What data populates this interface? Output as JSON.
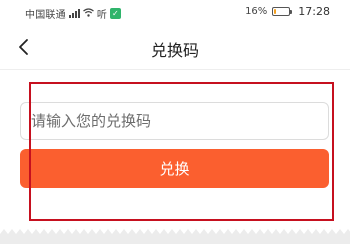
{
  "status_bar": {
    "carrier": "中国联通",
    "network_speed": "听",
    "battery_percent": "16%",
    "battery_level": 0.16,
    "time": "17:28"
  },
  "nav": {
    "title": "兑换码",
    "back_icon": "chevron-left-icon"
  },
  "form": {
    "code_placeholder": "请输入您的兑换码",
    "code_value": "",
    "redeem_label": "兑换"
  },
  "colors": {
    "accent": "#fb5f2f",
    "highlight_border": "#c6101f",
    "battery_fill": "#f4a020",
    "app_badge": "#2fb46b"
  }
}
